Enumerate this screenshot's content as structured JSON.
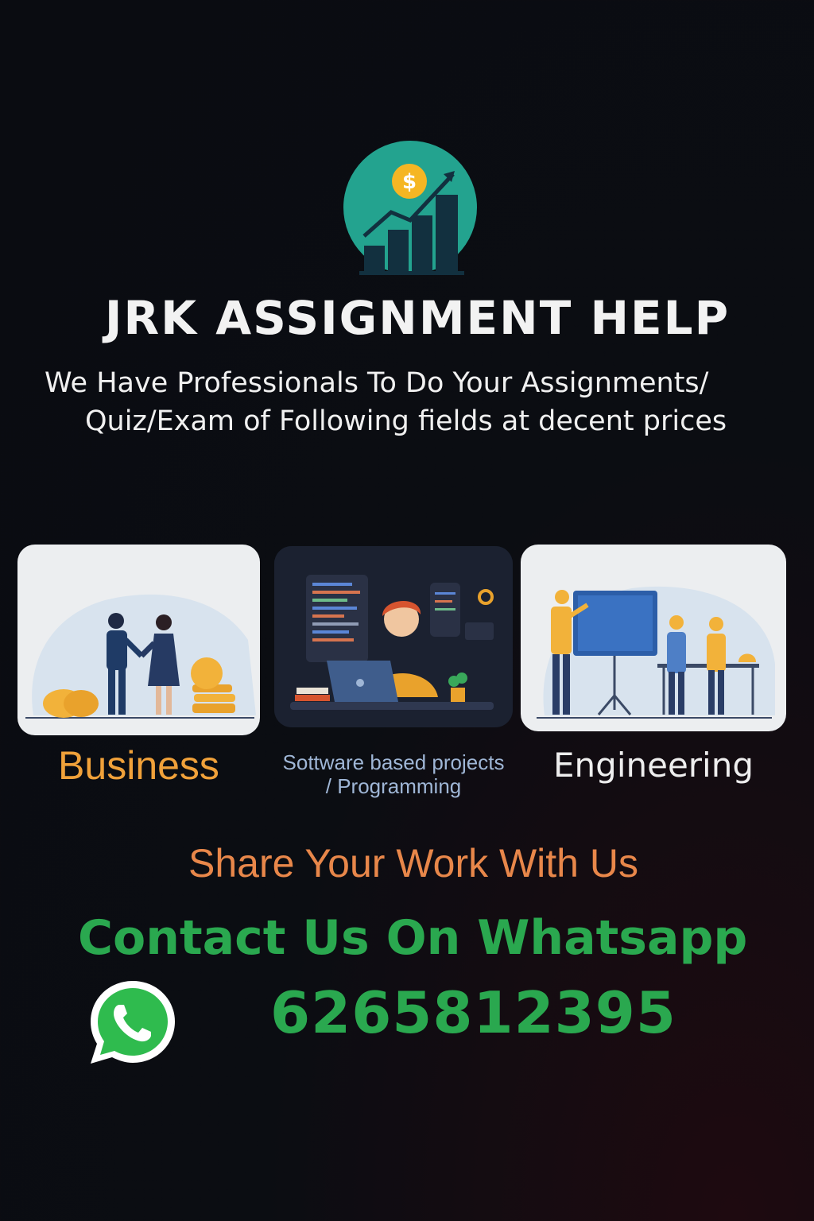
{
  "header": {
    "brand_title": "JRK ASSIGNMENT HELP",
    "tagline_line1": "We Have Professionals To Do Your Assignments/",
    "tagline_line2": "Quiz/Exam of Following fields at decent prices",
    "logo_icon": "growth-chart-dollar-icon"
  },
  "services": [
    {
      "label": "Business",
      "color": "#f0a13a",
      "illustration": "handshake-coins-illustration"
    },
    {
      "label_line1": "Sottware based projects",
      "label_line2": "/ Programming",
      "color": "#9fb6d6",
      "illustration": "programmer-laptop-illustration"
    },
    {
      "label": "Engineering",
      "color": "#eeeeee",
      "illustration": "engineers-blueprint-illustration"
    }
  ],
  "cta": {
    "share_text": "Share Your Work With Us",
    "contact_text": "Contact Us On Whatsapp",
    "phone_number": "6265812395",
    "whatsapp_icon": "whatsapp-icon"
  },
  "colors": {
    "background": "#0b0d12",
    "accent_green": "#2aa84f",
    "accent_orange": "#e8874a",
    "logo_teal": "#23a38f"
  }
}
